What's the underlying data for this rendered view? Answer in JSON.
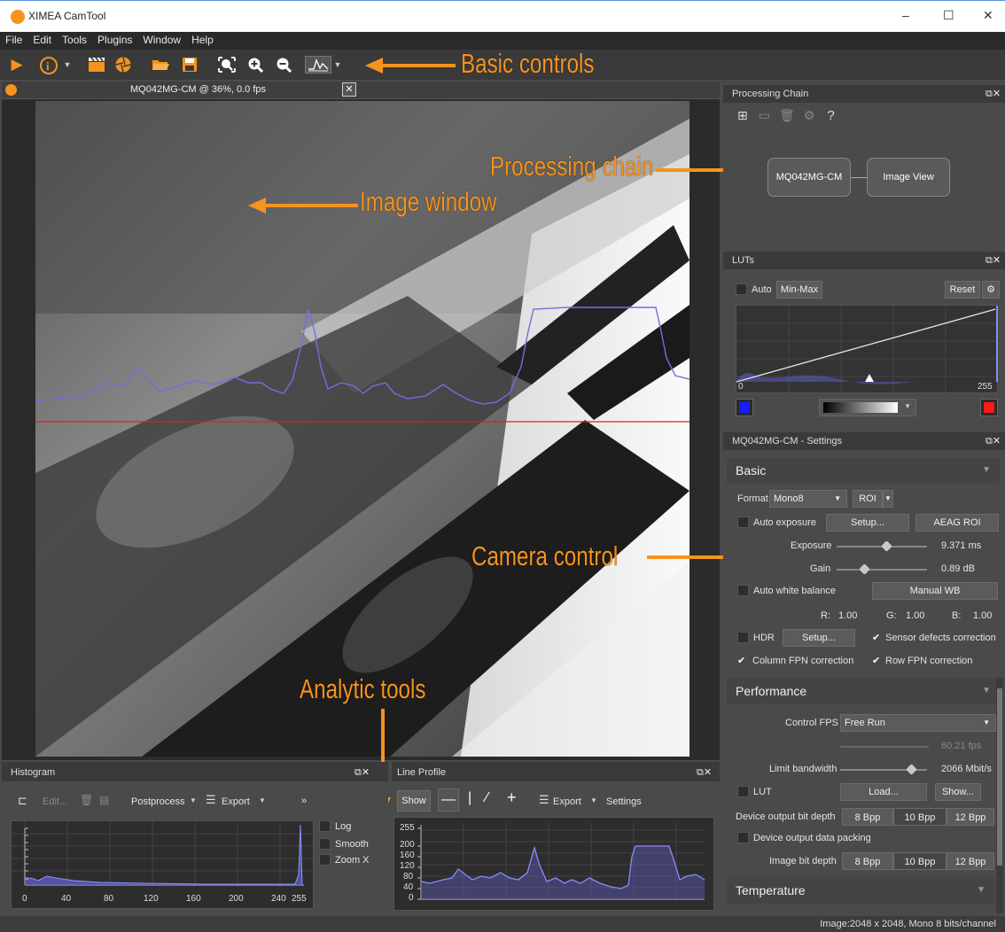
{
  "window": {
    "title": "XIMEA CamTool",
    "minimize": "–",
    "maximize": "☐",
    "close": "✕"
  },
  "menu": [
    "File",
    "Edit",
    "Tools",
    "Plugins",
    "Window",
    "Help"
  ],
  "annotations": {
    "basic_controls": "Basic controls",
    "processing_chain": "Processing chain",
    "image_window": "Image window",
    "camera_control": "Camera control",
    "analytic_tools": "Analytic tools"
  },
  "image_window": {
    "title": "MQ042MG-CM @ 36%, 0.0 fps",
    "close": "✕"
  },
  "processing_chain": {
    "title": "Processing Chain",
    "help": "?",
    "nodes": [
      "MQ042MG-CM",
      "Image View"
    ]
  },
  "luts": {
    "title": "LUTs",
    "auto_label": "Auto",
    "minmax_button": "Min-Max",
    "reset_button": "Reset",
    "axis_min": "0",
    "axis_max": "255",
    "left_color": "#1a1aff",
    "right_color": "#ff1a1a"
  },
  "settings": {
    "title": "MQ042MG-CM - Settings",
    "basic_header": "Basic",
    "format_label": "Format",
    "format_value": "Mono8",
    "roi_label": "ROI",
    "auto_exposure": "Auto exposure",
    "setup_button": "Setup...",
    "aeag_roi_button": "AEAG ROI",
    "exposure_label": "Exposure",
    "exposure_value": "9.371 ms",
    "exposure_level": 0.55,
    "gain_label": "Gain",
    "gain_value": "0.89 dB",
    "gain_level": 0.3,
    "auto_wb": "Auto white balance",
    "manual_wb_button": "Manual WB",
    "r_label": "R:",
    "r_value": "1.00",
    "g_label": "G:",
    "g_value": "1.00",
    "b_label": "B:",
    "b_value": "1.00",
    "hdr": "HDR",
    "hdr_setup": "Setup...",
    "sensor_defects": "Sensor defects correction",
    "column_fpn": "Column FPN correction",
    "row_fpn": "Row FPN correction",
    "performance_header": "Performance",
    "control_fps_label": "Control FPS",
    "control_fps_value": "Free Run",
    "fps_value": "60.21 fps",
    "limit_bandwidth_label": "Limit bandwidth",
    "limit_bandwidth_value": "2066 Mbit/s",
    "bandwidth_level": 0.82,
    "lut_label": "LUT",
    "load_button": "Load...",
    "show_button": "Show...",
    "device_output_bit_depth": "Device output bit depth",
    "device_output_data_packing": "Device output data packing",
    "image_bit_depth": "Image bit depth",
    "bpp": [
      "8 Bpp",
      "10 Bpp",
      "12 Bpp"
    ],
    "temperature_header": "Temperature"
  },
  "histogram": {
    "title": "Histogram",
    "edit": "Edit...",
    "postprocess": "Postprocess",
    "export": "Export",
    "more": "»",
    "log": "Log",
    "smooth": "Smooth",
    "zoom_x": "Zoom X",
    "x_ticks": [
      "0",
      "40",
      "80",
      "120",
      "160",
      "200",
      "240",
      "255"
    ]
  },
  "line_profile": {
    "title": "Line Profile",
    "show": "Show",
    "export": "Export",
    "settings": "Settings",
    "y_ticks": [
      "255",
      "200",
      "160",
      "120",
      "80",
      "40",
      "0"
    ]
  },
  "status": {
    "image_info": "Image:2048 x 2048, Mono 8 bits/channel"
  },
  "colors": {
    "accent": "#f6931e",
    "profile_line": "#6f6fe0",
    "red_line": "#e02020"
  }
}
